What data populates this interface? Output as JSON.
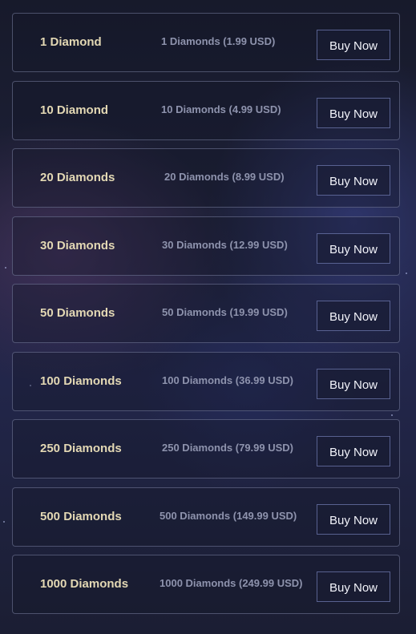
{
  "packages": [
    {
      "name": "1 Diamond",
      "description": "1 Diamonds (1.99 USD)",
      "button_label": "Buy Now"
    },
    {
      "name": "10 Diamond",
      "description": "10 Diamonds (4.99 USD)",
      "button_label": "Buy Now"
    },
    {
      "name": "20 Diamonds",
      "description": "20 Diamonds (8.99 USD)",
      "button_label": "Buy Now"
    },
    {
      "name": "30 Diamonds",
      "description": "30 Diamonds (12.99 USD)",
      "button_label": "Buy Now"
    },
    {
      "name": "50 Diamonds",
      "description": "50 Diamonds (19.99 USD)",
      "button_label": "Buy Now"
    },
    {
      "name": "100 Diamonds",
      "description": "100 Diamonds (36.99 USD)",
      "button_label": "Buy Now"
    },
    {
      "name": "250 Diamonds",
      "description": "250 Diamonds (79.99 USD)",
      "button_label": "Buy Now"
    },
    {
      "name": "500 Diamonds",
      "description": "500 Diamonds (149.99 USD)",
      "button_label": "Buy Now"
    },
    {
      "name": "1000 Diamonds",
      "description": "1000 Diamonds (249.99 USD)",
      "button_label": "Buy Now"
    }
  ],
  "colors": {
    "name_text": "#e3d8b4",
    "description_text": "#8e93ad",
    "button_text": "#f2f3fa",
    "row_border": "#5b6078",
    "background": "#1d2037"
  }
}
